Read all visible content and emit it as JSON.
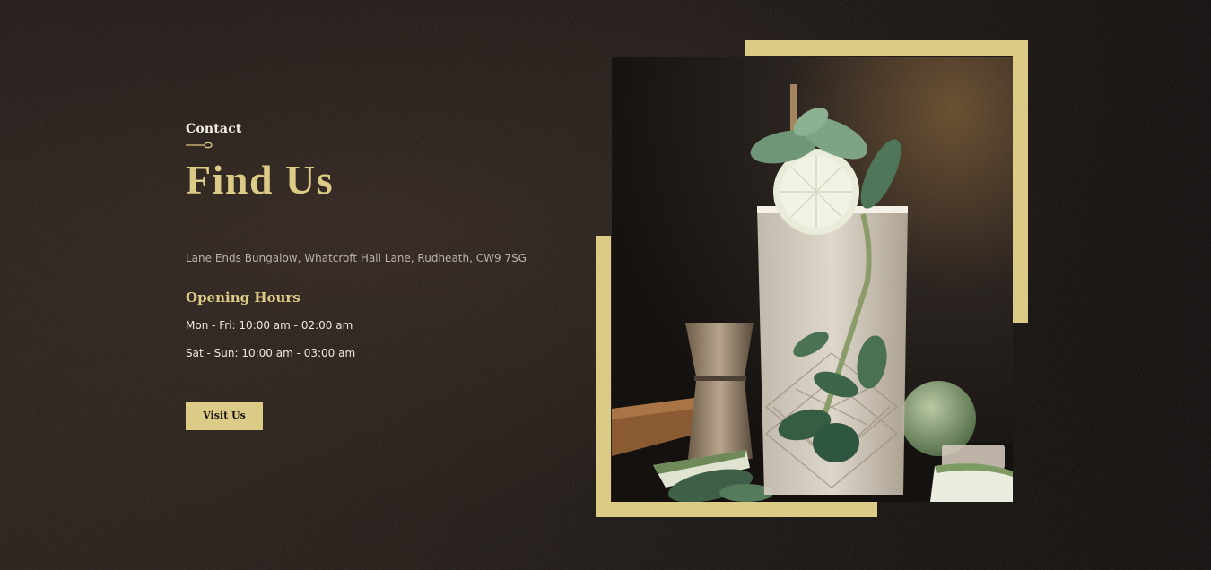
{
  "section": {
    "eyebrow": "Contact",
    "title": "Find Us",
    "address": "Lane Ends Bungalow, Whatcroft Hall Lane, Rudheath, CW9 7SG"
  },
  "hours": {
    "title": "Opening Hours",
    "weekdays": "Mon - Fri: 10:00 am - 02:00 am",
    "weekend": "Sat - Sun: 10:00 am - 03:00 am"
  },
  "cta": {
    "label": "Visit Us"
  },
  "image": {
    "subject": "cocktail-photo",
    "icon": "mint-cocktail-glass-icon"
  },
  "colors": {
    "accent": "#dccb86",
    "background": "#0b0908",
    "text": "#e6e1d8",
    "muted_text": "#b9b3aa"
  }
}
